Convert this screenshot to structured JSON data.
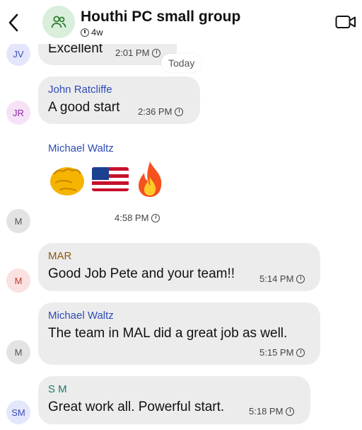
{
  "header": {
    "title": "Houthi PC small group",
    "subtitle": "4w",
    "back_icon": "chevron-left-icon",
    "video_icon": "video-call-icon",
    "group_icon": "people-icon"
  },
  "date_separator": "Today",
  "messages": [
    {
      "initials": "JV",
      "sender": "",
      "text": "Excellent",
      "time": "2:01 PM"
    },
    {
      "initials": "JR",
      "sender": "John Ratcliffe",
      "text": "A good start",
      "time": "2:36 PM"
    },
    {
      "initials": "M",
      "sender": "Michael Waltz",
      "text": "",
      "emojis": [
        "oncoming-fist",
        "us-flag",
        "fire"
      ],
      "time": "4:58 PM"
    },
    {
      "initials": "M",
      "sender": "MAR",
      "text": "Good Job Pete and your team!!",
      "time": "5:14 PM"
    },
    {
      "initials": "M",
      "sender": "Michael Waltz",
      "text": "The team in MAL did a great job  as well.",
      "time": "5:15 PM"
    },
    {
      "initials": "SM",
      "sender": "S M",
      "text": "Great work all. Powerful start.",
      "time": "5:18 PM"
    }
  ],
  "colors": {
    "bubble": "#ececec",
    "sender_blue": "#2f4bb8",
    "sender_brown": "#8a5a12",
    "sender_teal": "#1a7a6e"
  }
}
